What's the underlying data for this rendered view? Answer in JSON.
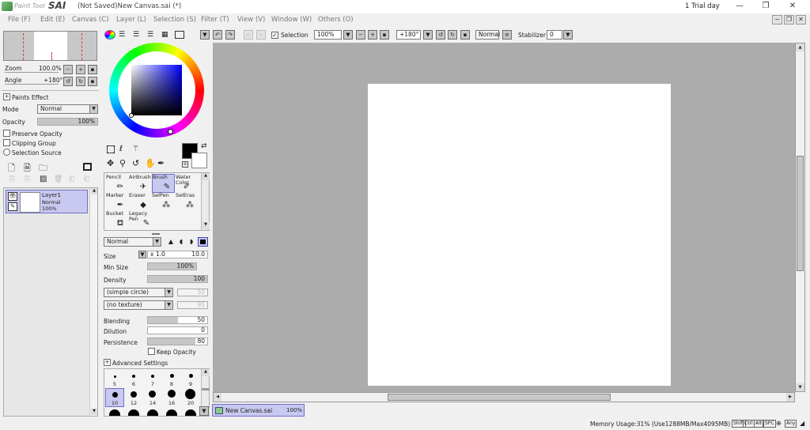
{
  "app": {
    "logo_text": "Paint Tool",
    "logo_sai": "SAI",
    "title": "(Not Saved)New Canvas.sai (*)",
    "trial": "1 Trial day"
  },
  "window_buttons": {
    "minimize": "—",
    "maximize": "❐",
    "close": "✕"
  },
  "menu": [
    {
      "label": "File (F)"
    },
    {
      "label": "Edit (E)"
    },
    {
      "label": "Canvas (C)"
    },
    {
      "label": "Layer (L)"
    },
    {
      "label": "Selection (S)"
    },
    {
      "label": "Filter (T)"
    },
    {
      "label": "View (V)"
    },
    {
      "label": "Window (W)"
    },
    {
      "label": "Others (O)"
    }
  ],
  "mdi_buttons": {
    "minimize": "−",
    "restore": "❐",
    "close": "✕"
  },
  "navigator": {
    "zoom_label": "Zoom",
    "zoom_value": "100.0%",
    "angle_label": "Angle",
    "angle_value": "+180°"
  },
  "layer_panel": {
    "paints_effect": "Paints Effect",
    "mode_label": "Mode",
    "mode_value": "Normal",
    "opacity_label": "Opacity",
    "opacity_value": "100%",
    "preserve_opacity": "Preserve Opacity",
    "clipping_group": "Clipping Group",
    "selection_source": "Selection Source",
    "layer": {
      "name": "Layer1",
      "mode": "Normal",
      "opacity": "100%"
    }
  },
  "toolbar": {
    "selection_label": "Selection",
    "zoom": "100%",
    "angle": "+180°",
    "blend": "Normal",
    "stabilizer_label": "Stabilizer",
    "stabilizer_value": "0"
  },
  "colors": {
    "primary": "#000000",
    "secondary": "#ffffff",
    "canvas_bg": "#acacac",
    "selected": "#c8c8f0"
  },
  "tools": [
    {
      "name": "Pencil",
      "label": "Pencil",
      "icon": "pencil-icon"
    },
    {
      "name": "AirBrush",
      "label": "AirBrush",
      "icon": "airbrush-icon"
    },
    {
      "name": "Brush",
      "label": "Brush",
      "icon": "brush-icon"
    },
    {
      "name": "Water",
      "label": "Water Color",
      "icon": "watercolor-icon"
    },
    {
      "name": "Marker",
      "label": "Marker",
      "icon": "marker-icon"
    },
    {
      "name": "Eraser",
      "label": "Eraser",
      "icon": "eraser-icon"
    },
    {
      "name": "SelPen",
      "label": "SelPen",
      "icon": "selpen-icon"
    },
    {
      "name": "SelEras",
      "label": "SelEras",
      "icon": "seleras-icon"
    },
    {
      "name": "Bucket",
      "label": "Bucket",
      "icon": "bucket-icon"
    },
    {
      "name": "Legacy",
      "label": "Legacy Pen",
      "icon": "legacy-pen-icon"
    }
  ],
  "brush": {
    "blend_mode": "Normal",
    "size_label": "Size",
    "size_mult": "x 1.0",
    "size_value": "10.0",
    "min_size_label": "Min Size",
    "min_size_value": "100%",
    "density_label": "Density",
    "density_value": "100",
    "shape": "(simple circle)",
    "shape_value": "50",
    "texture": "(no texture)",
    "texture_value": "95",
    "blending_label": "Blending",
    "blending_value": "50",
    "dilution_label": "Dilution",
    "dilution_value": "0",
    "persistence_label": "Persistence",
    "persistence_value": "80",
    "keep_opacity": "Keep Opacity",
    "advanced": "Advanced Settings"
  },
  "brush_sizes": [
    "5",
    "6",
    "7",
    "8",
    "9",
    "10",
    "12",
    "14",
    "16",
    "20"
  ],
  "canvas_tab": {
    "name": "New Canvas.sai",
    "zoom": "100%"
  },
  "status": {
    "memory": "Memory Usage:31% (Use1288MB/Max4095MB)",
    "keys": [
      "Shift",
      "Ctrl",
      "Alt",
      "SPC",
      "⊕",
      "Any"
    ]
  }
}
